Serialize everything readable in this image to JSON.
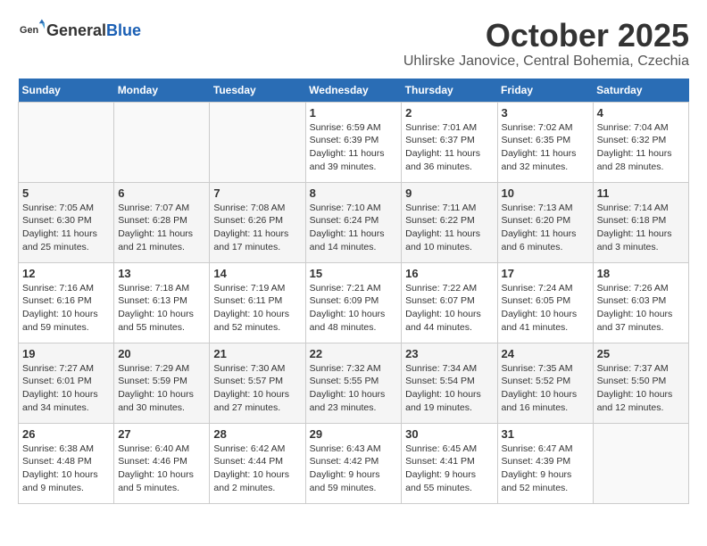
{
  "header": {
    "logo_general": "General",
    "logo_blue": "Blue",
    "month": "October 2025",
    "location": "Uhlirske Janovice, Central Bohemia, Czechia"
  },
  "days_of_week": [
    "Sunday",
    "Monday",
    "Tuesday",
    "Wednesday",
    "Thursday",
    "Friday",
    "Saturday"
  ],
  "weeks": [
    [
      {
        "day": "",
        "info": ""
      },
      {
        "day": "",
        "info": ""
      },
      {
        "day": "",
        "info": ""
      },
      {
        "day": "1",
        "info": "Sunrise: 6:59 AM\nSunset: 6:39 PM\nDaylight: 11 hours and 39 minutes."
      },
      {
        "day": "2",
        "info": "Sunrise: 7:01 AM\nSunset: 6:37 PM\nDaylight: 11 hours and 36 minutes."
      },
      {
        "day": "3",
        "info": "Sunrise: 7:02 AM\nSunset: 6:35 PM\nDaylight: 11 hours and 32 minutes."
      },
      {
        "day": "4",
        "info": "Sunrise: 7:04 AM\nSunset: 6:32 PM\nDaylight: 11 hours and 28 minutes."
      }
    ],
    [
      {
        "day": "5",
        "info": "Sunrise: 7:05 AM\nSunset: 6:30 PM\nDaylight: 11 hours and 25 minutes."
      },
      {
        "day": "6",
        "info": "Sunrise: 7:07 AM\nSunset: 6:28 PM\nDaylight: 11 hours and 21 minutes."
      },
      {
        "day": "7",
        "info": "Sunrise: 7:08 AM\nSunset: 6:26 PM\nDaylight: 11 hours and 17 minutes."
      },
      {
        "day": "8",
        "info": "Sunrise: 7:10 AM\nSunset: 6:24 PM\nDaylight: 11 hours and 14 minutes."
      },
      {
        "day": "9",
        "info": "Sunrise: 7:11 AM\nSunset: 6:22 PM\nDaylight: 11 hours and 10 minutes."
      },
      {
        "day": "10",
        "info": "Sunrise: 7:13 AM\nSunset: 6:20 PM\nDaylight: 11 hours and 6 minutes."
      },
      {
        "day": "11",
        "info": "Sunrise: 7:14 AM\nSunset: 6:18 PM\nDaylight: 11 hours and 3 minutes."
      }
    ],
    [
      {
        "day": "12",
        "info": "Sunrise: 7:16 AM\nSunset: 6:16 PM\nDaylight: 10 hours and 59 minutes."
      },
      {
        "day": "13",
        "info": "Sunrise: 7:18 AM\nSunset: 6:13 PM\nDaylight: 10 hours and 55 minutes."
      },
      {
        "day": "14",
        "info": "Sunrise: 7:19 AM\nSunset: 6:11 PM\nDaylight: 10 hours and 52 minutes."
      },
      {
        "day": "15",
        "info": "Sunrise: 7:21 AM\nSunset: 6:09 PM\nDaylight: 10 hours and 48 minutes."
      },
      {
        "day": "16",
        "info": "Sunrise: 7:22 AM\nSunset: 6:07 PM\nDaylight: 10 hours and 44 minutes."
      },
      {
        "day": "17",
        "info": "Sunrise: 7:24 AM\nSunset: 6:05 PM\nDaylight: 10 hours and 41 minutes."
      },
      {
        "day": "18",
        "info": "Sunrise: 7:26 AM\nSunset: 6:03 PM\nDaylight: 10 hours and 37 minutes."
      }
    ],
    [
      {
        "day": "19",
        "info": "Sunrise: 7:27 AM\nSunset: 6:01 PM\nDaylight: 10 hours and 34 minutes."
      },
      {
        "day": "20",
        "info": "Sunrise: 7:29 AM\nSunset: 5:59 PM\nDaylight: 10 hours and 30 minutes."
      },
      {
        "day": "21",
        "info": "Sunrise: 7:30 AM\nSunset: 5:57 PM\nDaylight: 10 hours and 27 minutes."
      },
      {
        "day": "22",
        "info": "Sunrise: 7:32 AM\nSunset: 5:55 PM\nDaylight: 10 hours and 23 minutes."
      },
      {
        "day": "23",
        "info": "Sunrise: 7:34 AM\nSunset: 5:54 PM\nDaylight: 10 hours and 19 minutes."
      },
      {
        "day": "24",
        "info": "Sunrise: 7:35 AM\nSunset: 5:52 PM\nDaylight: 10 hours and 16 minutes."
      },
      {
        "day": "25",
        "info": "Sunrise: 7:37 AM\nSunset: 5:50 PM\nDaylight: 10 hours and 12 minutes."
      }
    ],
    [
      {
        "day": "26",
        "info": "Sunrise: 6:38 AM\nSunset: 4:48 PM\nDaylight: 10 hours and 9 minutes."
      },
      {
        "day": "27",
        "info": "Sunrise: 6:40 AM\nSunset: 4:46 PM\nDaylight: 10 hours and 5 minutes."
      },
      {
        "day": "28",
        "info": "Sunrise: 6:42 AM\nSunset: 4:44 PM\nDaylight: 10 hours and 2 minutes."
      },
      {
        "day": "29",
        "info": "Sunrise: 6:43 AM\nSunset: 4:42 PM\nDaylight: 9 hours and 59 minutes."
      },
      {
        "day": "30",
        "info": "Sunrise: 6:45 AM\nSunset: 4:41 PM\nDaylight: 9 hours and 55 minutes."
      },
      {
        "day": "31",
        "info": "Sunrise: 6:47 AM\nSunset: 4:39 PM\nDaylight: 9 hours and 52 minutes."
      },
      {
        "day": "",
        "info": ""
      }
    ]
  ]
}
